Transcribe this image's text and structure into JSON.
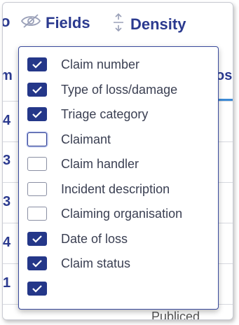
{
  "toolbar": {
    "partial_left": "o",
    "fields_label": "Fields",
    "density_label": "Density"
  },
  "table": {
    "header_left": "m",
    "header_right": "os",
    "row_digits": [
      "4",
      "3",
      "3",
      "4",
      "1"
    ],
    "bottom_partial": "Publiced"
  },
  "columns_menu": {
    "options": [
      {
        "label": "Claim number",
        "checked": true
      },
      {
        "label": "Type of loss/damage",
        "checked": true
      },
      {
        "label": "Triage category",
        "checked": true
      },
      {
        "label": "Claimant",
        "checked": false
      },
      {
        "label": "Claim handler",
        "checked": false
      },
      {
        "label": "Incident description",
        "checked": false
      },
      {
        "label": "Claiming organisation",
        "checked": false
      },
      {
        "label": "Date of loss",
        "checked": true
      },
      {
        "label": "Claim status",
        "checked": true
      },
      {
        "label": "",
        "checked": true
      }
    ]
  },
  "colors": {
    "accent": "#2b3a8f",
    "checkbox_checked": "#243789",
    "header_underline": "#3d8bd6"
  }
}
